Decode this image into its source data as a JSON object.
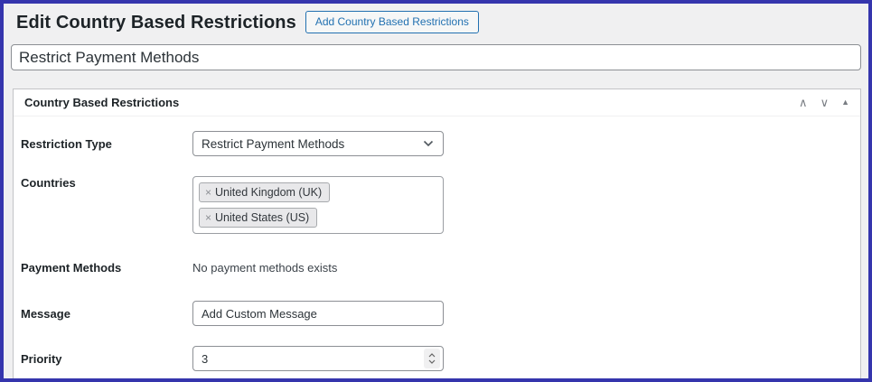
{
  "colors": {
    "frame_border": "#3535ad",
    "page_background": "#f0f0f1",
    "accent_blue": "#2271b1",
    "metabox_border": "#c3c4c7",
    "input_border": "#8c8f94",
    "heading_text": "#1d2327"
  },
  "header": {
    "title": "Edit Country Based Restrictions",
    "add_button": "Add Country Based Restrictions"
  },
  "title_field": {
    "value": "Restrict Payment Methods"
  },
  "metabox": {
    "title": "Country Based Restrictions",
    "icons": {
      "move_up": "∧",
      "move_down": "∨",
      "toggle": "▲"
    }
  },
  "fields": {
    "restriction_type": {
      "label": "Restriction Type",
      "selected": "Restrict Payment Methods"
    },
    "countries": {
      "label": "Countries",
      "tags": [
        {
          "remove": "×",
          "label": "United Kingdom (UK)"
        },
        {
          "remove": "×",
          "label": "United States (US)"
        }
      ]
    },
    "payment_methods": {
      "label": "Payment Methods",
      "status": "No payment methods exists"
    },
    "message": {
      "label": "Message",
      "value": "Add Custom Message"
    },
    "priority": {
      "label": "Priority",
      "value": "3"
    }
  }
}
